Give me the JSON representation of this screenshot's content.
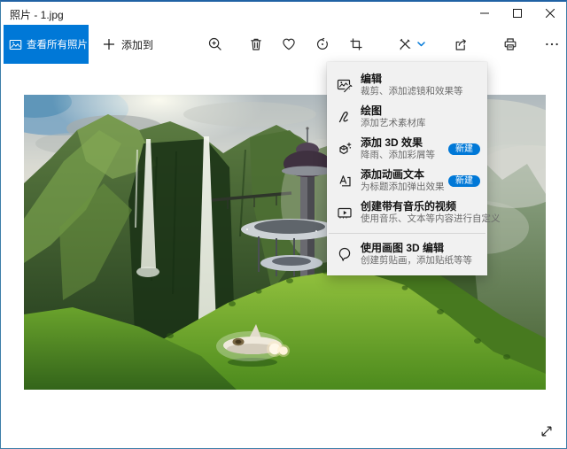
{
  "window": {
    "title": "照片 - 1.jpg",
    "controls": [
      {
        "name": "minimize",
        "icon": "minimize-icon"
      },
      {
        "name": "maximize",
        "icon": "maximize-icon"
      },
      {
        "name": "close",
        "icon": "close-icon"
      }
    ]
  },
  "toolbar": {
    "view_all_label": "查看所有照片",
    "view_all_icon": "photos-icon",
    "add_to_label": "添加到",
    "add_to_icon": "plus-icon",
    "icons": [
      "zoom-in-icon",
      "delete-icon",
      "favorite-icon",
      "rotate-icon",
      "crop-icon",
      "edit-create-icon",
      "chevron-down-icon",
      "share-icon",
      "print-icon",
      "see-more-icon"
    ]
  },
  "menu": {
    "items": [
      {
        "title": "编辑",
        "subtitle": "裁剪、添加滤镜和效果等",
        "icon": "edit-photo-icon"
      },
      {
        "title": "绘图",
        "subtitle": "添加艺术素材库",
        "icon": "draw-icon"
      },
      {
        "title": "添加 3D 效果",
        "subtitle": "降雨、添加彩屑等",
        "icon": "3d-effects-icon",
        "badge": "新建"
      },
      {
        "title": "添加动画文本",
        "subtitle": "为标题添加弹出效果",
        "icon": "animated-text-icon",
        "badge": "新建"
      },
      {
        "title": "创建带有音乐的视频",
        "subtitle": "使用音乐、文本等内容进行自定义",
        "icon": "video-music-icon"
      },
      {
        "title": "使用画图 3D 编辑",
        "subtitle": "创建剪贴画，添加贴纸等等",
        "icon": "paint3d-icon"
      }
    ]
  },
  "photo": {
    "description": "绿色山谷瀑布与未来建筑的风景图片",
    "fullscreen_icon": "fullscreen-icon"
  },
  "colors": {
    "accent": "#0078d7",
    "menu_bg": "#f1f1f1",
    "badge_bg": "#0078d7",
    "window_border": "#3d7ea8"
  }
}
